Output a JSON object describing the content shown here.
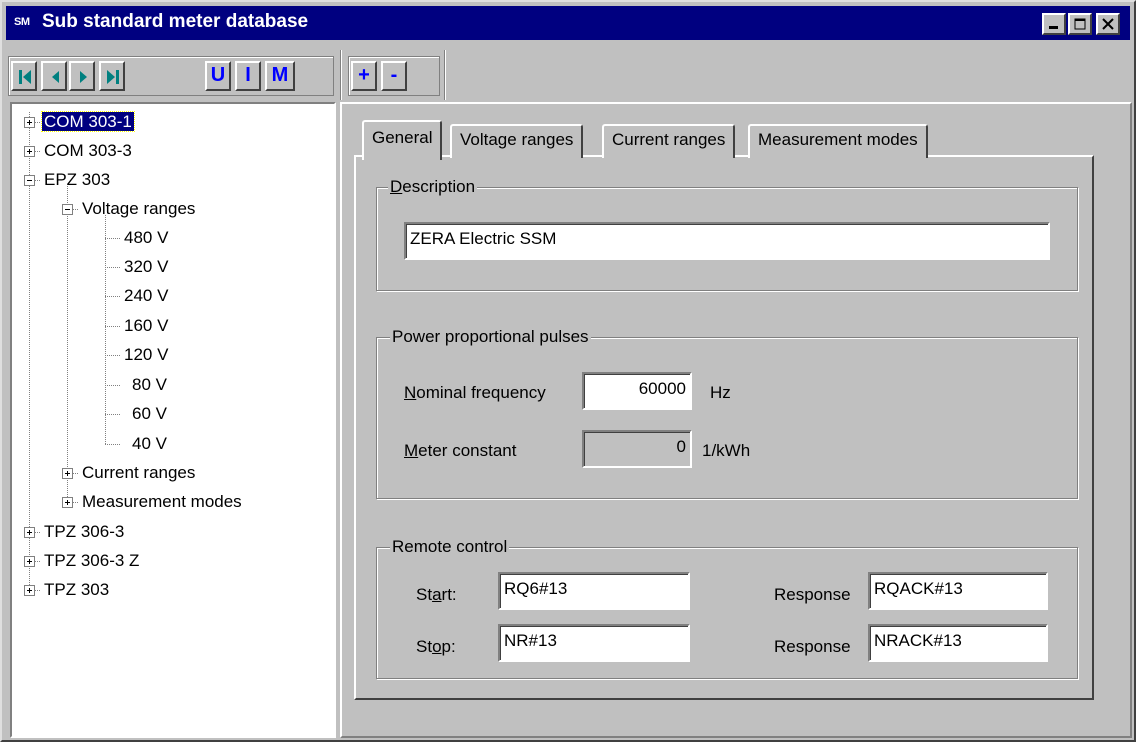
{
  "window": {
    "icon_text": "SM",
    "title": "Sub standard meter database"
  },
  "toolbar": {
    "nav": [
      "first-record-icon",
      "previous-record-icon",
      "next-record-icon",
      "last-record-icon"
    ],
    "u_label": "U",
    "i_label": "I",
    "m_label": "M",
    "add_label": "+",
    "remove_label": "-"
  },
  "tree": {
    "n0": "COM 303-1",
    "n1": "COM 303-3",
    "n2": "EPZ 303",
    "n3": "Voltage ranges",
    "n4": "480 V",
    "n5": "320 V",
    "n6": "240 V",
    "n7": "160 V",
    "n8": "120 V",
    "n9": "80 V",
    "n10": "60 V",
    "n11": "40 V",
    "n12": "Current ranges",
    "n13": "Measurement modes",
    "n14": "TPZ 306-3",
    "n15": "TPZ 306-3 Z",
    "n16": "TPZ 303"
  },
  "tabs": {
    "general": "General",
    "voltage": "Voltage ranges",
    "current": "Current ranges",
    "modes": "Measurement modes"
  },
  "description": {
    "legend_key": "D",
    "legend_rest": "escription",
    "value": "ZERA Electric SSM"
  },
  "pulses": {
    "legend": "Power proportional pulses",
    "freq_key": "N",
    "freq_rest": "ominal frequency",
    "freq_value": "60000",
    "freq_unit": "Hz",
    "const_key": "M",
    "const_rest": "eter constant",
    "const_value": "0",
    "const_unit": "1/kWh"
  },
  "remote": {
    "legend": "Remote control",
    "start_pre": "St",
    "start_key": "a",
    "start_post": "rt:",
    "start_value": "RQ6#13",
    "stop_pre": "St",
    "stop_key": "o",
    "stop_post": "p:",
    "stop_value": "NR#13",
    "response_label": "Response",
    "start_response": "RQACK#13",
    "stop_response": "NRACK#13"
  }
}
